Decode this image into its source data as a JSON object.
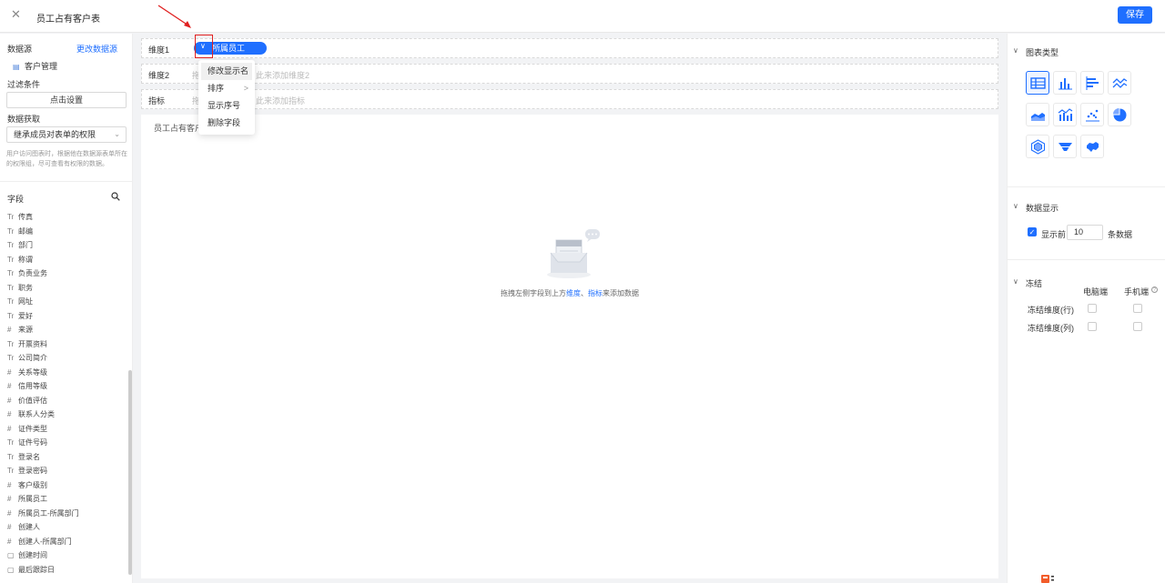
{
  "header": {
    "title": "员工占有客户表",
    "save_label": "保存",
    "close_icon": "close-icon"
  },
  "left": {
    "datasource_label": "数据源",
    "change_datasource": "更改数据源",
    "datasource_item": "客户管理",
    "filter_label": "过滤条件",
    "filter_button": "点击设置",
    "fetch_label": "数据获取",
    "fetch_select": "继承成员对表单的权限",
    "fetch_hint": "用户访问图表时，根据他在数据源表单所在的权限组，尽可查看有权限的数据。",
    "fields_label": "字段",
    "fields": [
      {
        "type": "Tr",
        "name": "传真"
      },
      {
        "type": "Tr",
        "name": "邮编"
      },
      {
        "type": "Tr",
        "name": "部门"
      },
      {
        "type": "Tr",
        "name": "称谓"
      },
      {
        "type": "Tr",
        "name": "负责业务"
      },
      {
        "type": "Tr",
        "name": "职务"
      },
      {
        "type": "Tr",
        "name": "网址"
      },
      {
        "type": "Tr",
        "name": "爱好"
      },
      {
        "type": "#",
        "name": "来源"
      },
      {
        "type": "Tr",
        "name": "开票资料"
      },
      {
        "type": "Tr",
        "name": "公司简介"
      },
      {
        "type": "#",
        "name": "关系等级"
      },
      {
        "type": "#",
        "name": "信用等级"
      },
      {
        "type": "#",
        "name": "价值评估"
      },
      {
        "type": "#",
        "name": "联系人分类"
      },
      {
        "type": "#",
        "name": "证件类型"
      },
      {
        "type": "Tr",
        "name": "证件号码"
      },
      {
        "type": "Tr",
        "name": "登录名"
      },
      {
        "type": "Tr",
        "name": "登录密码"
      },
      {
        "type": "#",
        "name": "客户级别"
      },
      {
        "type": "#",
        "name": "所属员工"
      },
      {
        "type": "#",
        "name": "所属员工-所属部门"
      },
      {
        "type": "#",
        "name": "创建人"
      },
      {
        "type": "#",
        "name": "创建人-所属部门"
      },
      {
        "type": "cal",
        "name": "创建时间"
      },
      {
        "type": "cal",
        "name": "最后跟踪日"
      }
    ]
  },
  "main": {
    "dim1_label": "维度1",
    "dim1_pill": "所属员工",
    "dim2_label": "维度2",
    "dim2_placeholder": "拖",
    "dim2_placeholder_tail": "此来添加维度2",
    "metric_label": "指标",
    "metric_placeholder": "拖",
    "metric_placeholder_tail": "此来添加指标",
    "canvas_title": "员工占有客户",
    "empty_pre": "拖拽左侧字段到上方",
    "empty_dim": "维度",
    "empty_sep": "、",
    "empty_metric": "指标",
    "empty_post": "来添加数据"
  },
  "menu": {
    "items": [
      {
        "label": "修改显示名"
      },
      {
        "label": "排序"
      },
      {
        "label": "显示序号"
      },
      {
        "label": "删除字段"
      }
    ],
    "submenu_arrow": ">"
  },
  "right": {
    "chart_type_label": "图表类型",
    "data_display_label": "数据显示",
    "show_first_label": "显示前",
    "show_first_value": "10",
    "show_first_unit": "条数据",
    "freeze_label": "冻结",
    "pc_label": "电脑端",
    "mobile_label": "手机端",
    "help_mark": "?",
    "freeze_row": "冻结维度(行)",
    "freeze_col": "冻结维度(列)"
  },
  "colors": {
    "accent": "#1f6fff",
    "annotation": "#e02020"
  }
}
